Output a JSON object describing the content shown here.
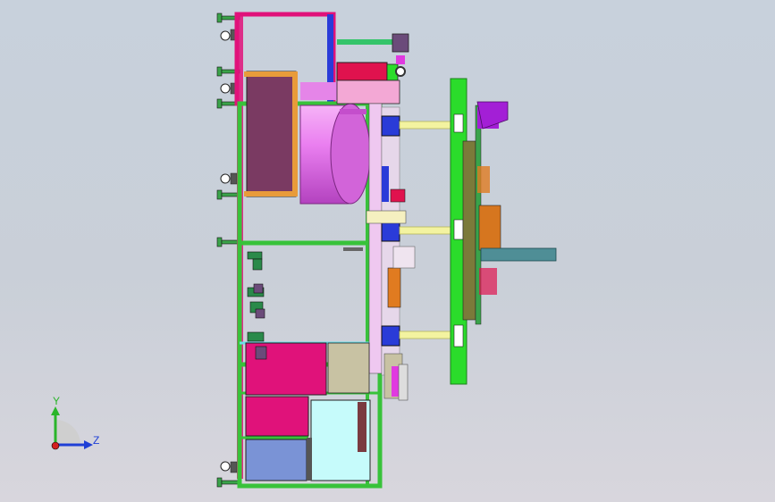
{
  "triad": {
    "y_label": "Y",
    "z_label": "Z",
    "y_color": "#2ab52a",
    "z_color": "#1f3fd6",
    "x_color": "#d42020"
  },
  "colors": {
    "frame_green": "#38c23a",
    "panel_magenta": "#e0127a",
    "roll_pink": "#ea7ff0",
    "cabinet_plum": "#7a3a62",
    "bracket_lime": "#2bdc2b",
    "axle_yellow": "#f3f3a0",
    "motor_blue": "#2a3bd8",
    "slate_blue": "#7a93d6",
    "pale_cyan": "#c6fbfb",
    "tan": "#c8c2a3",
    "orange": "#e07b20",
    "steel_teal": "#4f8e96",
    "purple": "#a31fd6"
  }
}
